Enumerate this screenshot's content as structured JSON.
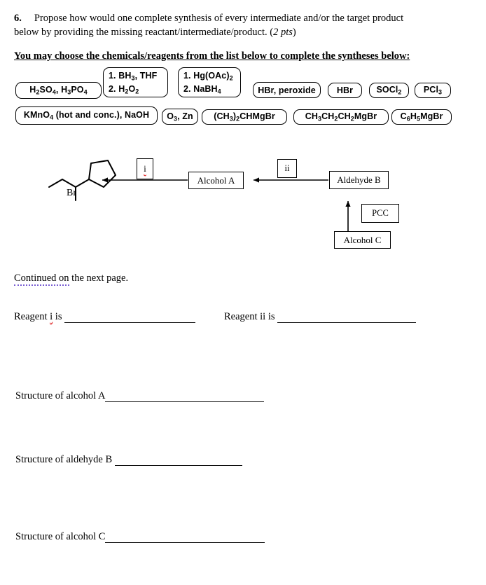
{
  "question": {
    "number": "6.",
    "text_line1": "Propose how would one complete synthesis of every intermediate and/or the target product",
    "text_line2_a": "below by providing the missing reactant/intermediate/product. (",
    "points": "2 pts",
    "text_line2_b": ")",
    "instruction": "You may choose the chemicals/reagents from the list below to complete the syntheses below:"
  },
  "reagent_bank": {
    "items": [
      {
        "name": "sulfuric-phosphoric-acid",
        "html": "H<sub>2</sub>SO<sub>4</sub>, H<sub>3</sub>PO<sub>4</sub>",
        "plain": "H2SO4, H3PO4"
      },
      {
        "name": "hydroboration-oxidation",
        "line1": "1. BH<sub>3</sub>, THF",
        "line2": "2.  H<sub>2</sub>O<sub>2</sub>",
        "plain": "1. BH3, THF / 2. H2O2"
      },
      {
        "name": "oxymercuration-demercuration",
        "line1": "1.  Hg(OAc)<sub>2</sub>",
        "line2": "2. NaBH<sub>4</sub>",
        "plain": "1. Hg(OAc)2 / 2. NaBH4"
      },
      {
        "name": "hbr-peroxide",
        "html": "HBr, peroxide",
        "plain": "HBr, peroxide"
      },
      {
        "name": "hbr",
        "html": "HBr",
        "plain": "HBr"
      },
      {
        "name": "thionyl-chloride",
        "html": "SOCl<sub>2</sub>",
        "plain": "SOCl2"
      },
      {
        "name": "phosphorus-trichloride",
        "html": "PCl<sub>3</sub>",
        "plain": "PCl3"
      },
      {
        "name": "potassium-permanganate-naoh",
        "html": "KMnO<sub>4</sub> (hot and conc.), NaOH",
        "plain": "KMnO4 (hot and conc.), NaOH"
      },
      {
        "name": "ozone-zinc",
        "html": "O<sub>3</sub>, Zn",
        "plain": "O3, Zn"
      },
      {
        "name": "isopropyl-magnesium-bromide",
        "html": "(CH<sub>3</sub>)<sub>2</sub>CHMgBr",
        "plain": "(CH3)2CHMgBr"
      },
      {
        "name": "propyl-magnesium-bromide",
        "html": "CH<sub>3</sub>CH<sub>2</sub>CH<sub>2</sub>MgBr",
        "plain": "CH3CH2CH2MgBr"
      },
      {
        "name": "phenyl-magnesium-bromide",
        "html": "C<sub>6</sub>H<sub>5</sub>MgBr",
        "plain": "C6H5MgBr"
      }
    ]
  },
  "scheme": {
    "product_structure_label": "Br",
    "reagent_i_label": "i",
    "reagent_ii_label": "ii",
    "nodes": [
      {
        "name": "alcohol-a",
        "label": "Alcohol A"
      },
      {
        "name": "aldehyde-b",
        "label": "Aldehyde B"
      },
      {
        "name": "alcohol-c",
        "label": "Alcohol C"
      },
      {
        "name": "pcc",
        "label": "PCC"
      }
    ]
  },
  "footer": {
    "continued_a": "Continued on",
    "continued_b": " the next page."
  },
  "answers": {
    "reagent_i_prompt_a": "Reagent ",
    "reagent_i_prompt_i": "i",
    "reagent_i_prompt_b": " is",
    "reagent_ii_prompt_a": "Reagent ii is",
    "structure_a": "Structure of alcohol A",
    "structure_b": "Structure of aldehyde B",
    "structure_c": "Structure of alcohol C"
  }
}
